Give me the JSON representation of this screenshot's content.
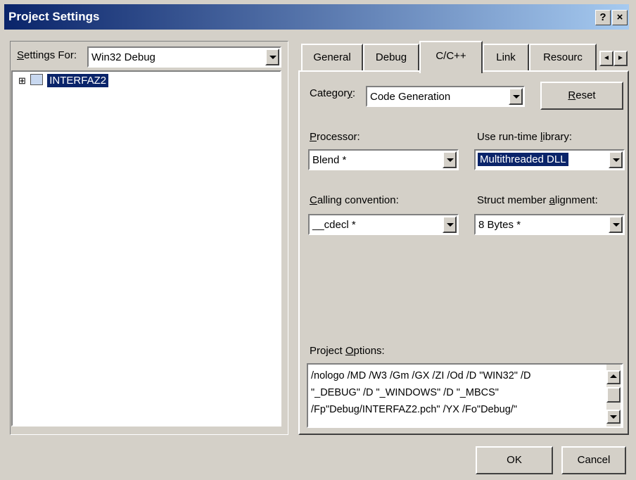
{
  "window": {
    "title": "Project Settings",
    "help_glyph": "?",
    "close_glyph": "×"
  },
  "settings_for": {
    "label_u": "S",
    "label_rest": "ettings For:",
    "value": "Win32 Debug"
  },
  "tree": {
    "expander": "⊞",
    "item": "INTERFAZ2"
  },
  "tabs": [
    "General",
    "Debug",
    "C/C++",
    "Link",
    "Resourc"
  ],
  "tab_scroll": {
    "left": "◄",
    "right": "►"
  },
  "category": {
    "label_pre": "Categor",
    "label_u": "y",
    "label_post": ":",
    "value": "Code Generation"
  },
  "reset_button": {
    "u": "R",
    "rest": "eset"
  },
  "processor": {
    "label_u": "P",
    "label_rest": "rocessor:",
    "value": "Blend *"
  },
  "runtime_library": {
    "label_pre": "Use run-time ",
    "label_u": "l",
    "label_post": "ibrary:",
    "value": "Multithreaded DLL"
  },
  "calling_convention": {
    "label_u": "C",
    "label_rest": "alling convention:",
    "value": "__cdecl *"
  },
  "struct_alignment": {
    "label_pre": "Struct member ",
    "label_u": "a",
    "label_post": "lignment:",
    "value": "8 Bytes *"
  },
  "project_options": {
    "label_pre": "Project ",
    "label_u": "O",
    "label_post": "ptions:",
    "lines": [
      "/nologo /MD /W3 /Gm /GX /ZI /Od /D \"WIN32\" /D",
      "\"_DEBUG\" /D \"_WINDOWS\" /D \"_MBCS\"",
      "/Fp\"Debug/INTERFAZ2.pch\" /YX /Fo\"Debug/\""
    ]
  },
  "buttons": {
    "ok": "OK",
    "cancel": "Cancel"
  },
  "colors": {
    "title_bar": "#0a246a",
    "face": "#d4d0c8",
    "highlight": "#0a246a"
  }
}
